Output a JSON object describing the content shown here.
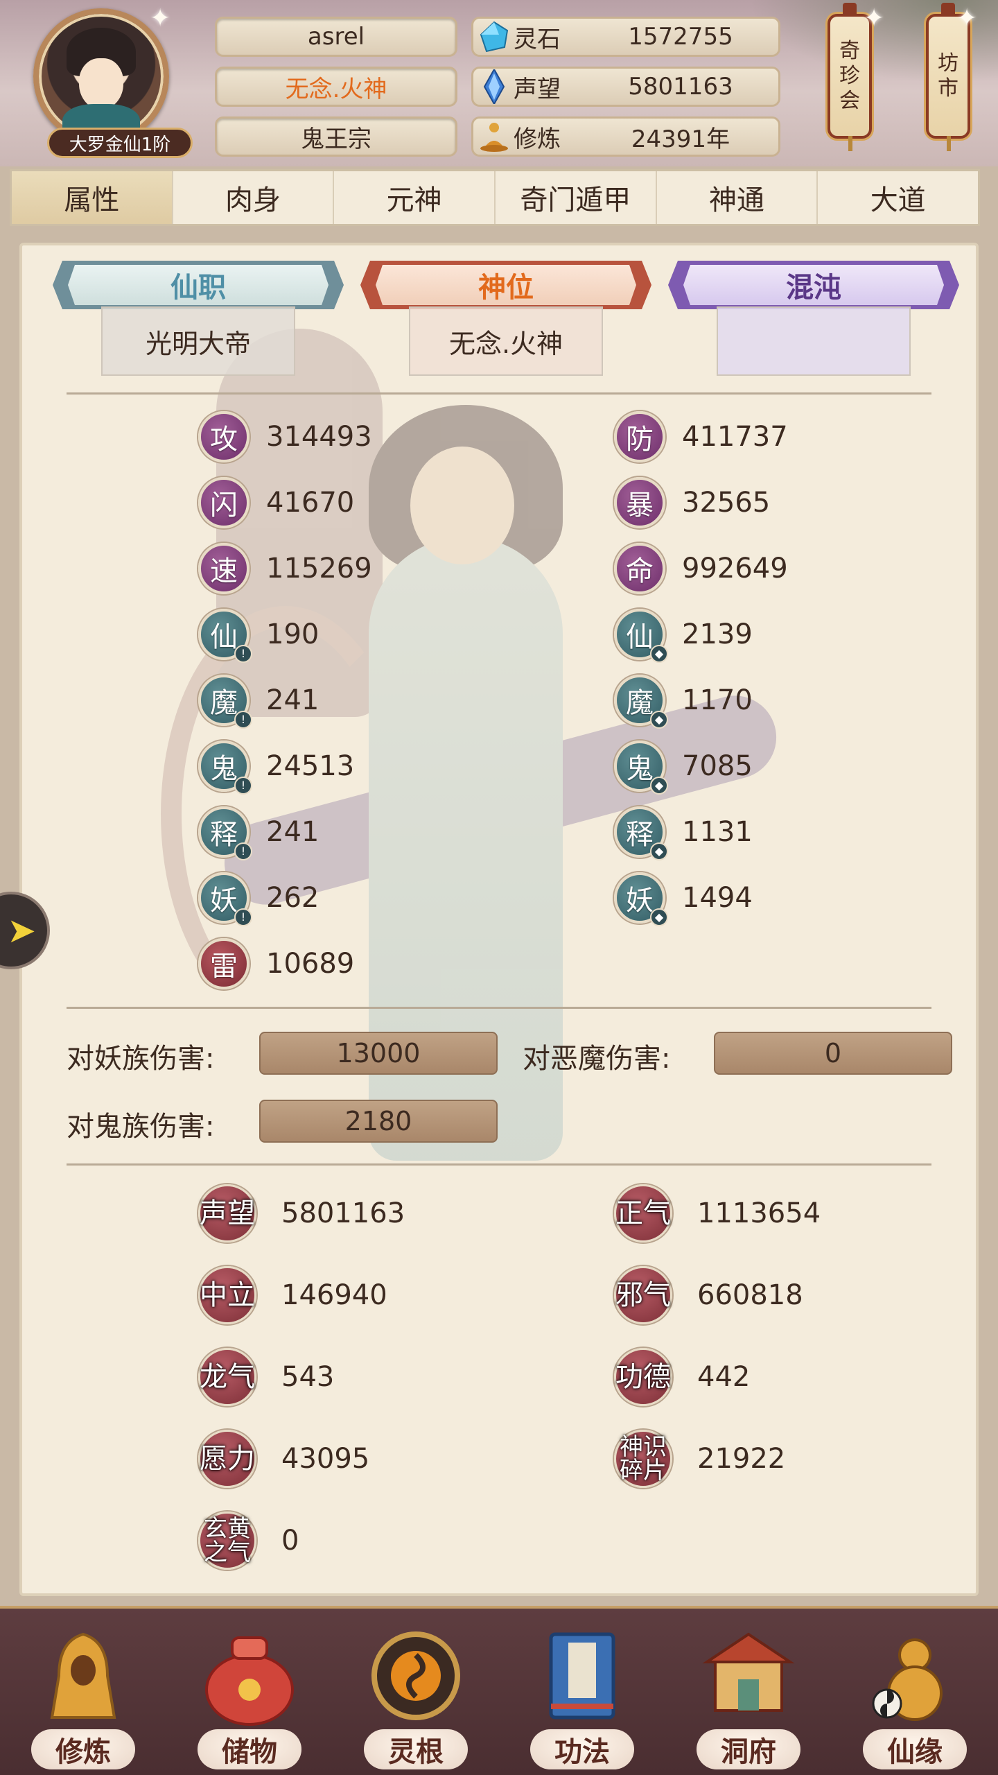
{
  "header": {
    "rank": "大罗金仙1阶",
    "player_name": "asrel",
    "title": "无念.火神",
    "sect": "鬼王宗",
    "resources": [
      {
        "icon": "spirit-stone-icon",
        "label": "灵石",
        "value": "1572755"
      },
      {
        "icon": "fame-crystal-icon",
        "label": "声望",
        "value": "5801163"
      },
      {
        "icon": "meditation-icon",
        "label": "修炼",
        "value": "24391年"
      }
    ],
    "lanterns": [
      {
        "lines": [
          "奇",
          "珍",
          "会"
        ]
      },
      {
        "lines": [
          "坊",
          "市"
        ]
      }
    ]
  },
  "tabs": [
    "属性",
    "肉身",
    "元神",
    "奇门遁甲",
    "神通",
    "大道"
  ],
  "active_tab": "属性",
  "titles": [
    {
      "banner": "仙职",
      "value": "光明大帝"
    },
    {
      "banner": "神位",
      "value": "无念.火神"
    },
    {
      "banner": "混沌",
      "value": ""
    }
  ],
  "stats": {
    "left": [
      {
        "glyph": "攻",
        "value": "314493",
        "color": "purple"
      },
      {
        "glyph": "闪",
        "value": "41670",
        "color": "purple"
      },
      {
        "glyph": "速",
        "value": "115269",
        "color": "purple"
      },
      {
        "glyph": "仙",
        "value": "190",
        "color": "teal",
        "sub": "!"
      },
      {
        "glyph": "魔",
        "value": "241",
        "color": "teal",
        "sub": "!"
      },
      {
        "glyph": "鬼",
        "value": "24513",
        "color": "teal",
        "sub": "!"
      },
      {
        "glyph": "释",
        "value": "241",
        "color": "teal",
        "sub": "!"
      },
      {
        "glyph": "妖",
        "value": "262",
        "color": "teal",
        "sub": "!"
      },
      {
        "glyph": "雷",
        "value": "10689",
        "color": "red"
      }
    ],
    "right": [
      {
        "glyph": "防",
        "value": "411737",
        "color": "purple"
      },
      {
        "glyph": "暴",
        "value": "32565",
        "color": "purple"
      },
      {
        "glyph": "命",
        "value": "992649",
        "color": "purple"
      },
      {
        "glyph": "仙",
        "value": "2139",
        "color": "teal",
        "sub": "◆"
      },
      {
        "glyph": "魔",
        "value": "1170",
        "color": "teal",
        "sub": "◆"
      },
      {
        "glyph": "鬼",
        "value": "7085",
        "color": "teal",
        "sub": "◆"
      },
      {
        "glyph": "释",
        "value": "1131",
        "color": "teal",
        "sub": "◆"
      },
      {
        "glyph": "妖",
        "value": "1494",
        "color": "teal",
        "sub": "◆"
      }
    ]
  },
  "damage": {
    "demon_race_label": "对妖族伤害:",
    "demon_race_value": "13000",
    "evil_demon_label": "对恶魔伤害:",
    "evil_demon_value": "0",
    "ghost_race_label": "对鬼族伤害:",
    "ghost_race_value": "2180"
  },
  "reputation": {
    "left": [
      {
        "label": "声望",
        "value": "5801163"
      },
      {
        "label": "中立",
        "value": "146940"
      },
      {
        "label": "龙气",
        "value": "543"
      },
      {
        "label": "愿力",
        "value": "43095"
      },
      {
        "label": "玄黄\n之气",
        "value": "0"
      }
    ],
    "right": [
      {
        "label": "正气",
        "value": "1113654"
      },
      {
        "label": "邪气",
        "value": "660818"
      },
      {
        "label": "功德",
        "value": "442"
      },
      {
        "label": "神识\n碎片",
        "value": "21922"
      }
    ]
  },
  "bottom_nav": [
    {
      "label": "修炼",
      "icon": "hooded-monk-icon"
    },
    {
      "label": "储物",
      "icon": "treasure-bag-icon"
    },
    {
      "label": "灵根",
      "icon": "spirit-root-orb-icon"
    },
    {
      "label": "功法",
      "icon": "manual-book-icon"
    },
    {
      "label": "洞府",
      "icon": "cave-mansion-icon"
    },
    {
      "label": "仙缘",
      "icon": "gourd-icon"
    }
  ],
  "colors": {
    "accent_orange": "#e26a1d",
    "badge_purple": "#6e2f6b",
    "badge_teal": "#335d65",
    "badge_red": "#7b2a33"
  }
}
